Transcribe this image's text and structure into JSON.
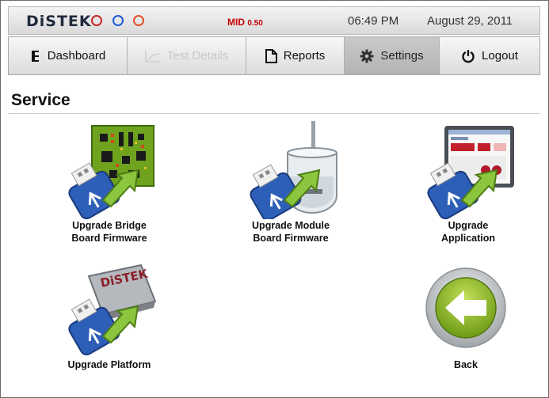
{
  "header": {
    "logo": "DiSTEK",
    "status_colors": [
      "#c62828",
      "#1e5bd6",
      "#e0502a"
    ],
    "mid_label": "MID",
    "mid_value": "0.50",
    "time": "06:49 PM",
    "date": "August 29, 2011"
  },
  "nav": {
    "tabs": [
      {
        "label": "Dashboard",
        "icon": "dashboard-icon"
      },
      {
        "label": "Test Details",
        "icon": "chart-icon",
        "disabled": true
      },
      {
        "label": "Reports",
        "icon": "document-icon"
      },
      {
        "label": "Settings",
        "icon": "gear-icon",
        "active": true
      },
      {
        "label": "Logout",
        "icon": "power-icon"
      }
    ]
  },
  "page": {
    "title": "Service",
    "items": [
      {
        "line1": "Upgrade Bridge",
        "line2": "Board Firmware",
        "icon": "bridge-board-usb-icon"
      },
      {
        "line1": "Upgrade Module",
        "line2": "Board Firmware",
        "icon": "dissolution-vessel-usb-icon"
      },
      {
        "line1": "Upgrade",
        "line2": "Application",
        "icon": "application-screen-usb-icon"
      },
      {
        "line1": "Upgrade Platform",
        "line2": "",
        "icon": "platform-chip-usb-icon"
      },
      {
        "line1": "Back",
        "line2": "",
        "icon": "back-arrow-icon"
      }
    ],
    "chip_logo": "DiSTEK"
  }
}
